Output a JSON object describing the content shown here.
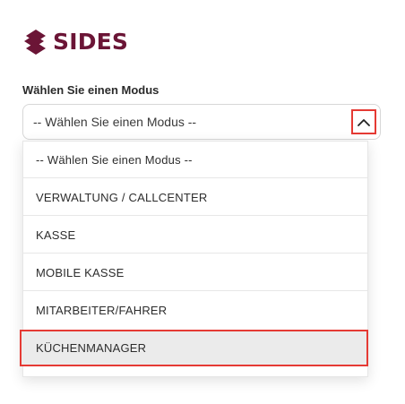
{
  "brand": {
    "name": "SIDES",
    "color": "#6b1536"
  },
  "mode_select": {
    "label": "Wählen Sie einen Modus",
    "selected": "-- Wählen Sie einen Modus --",
    "expanded": true,
    "toggle_icon": "chevron-up-icon",
    "options": [
      "-- Wählen Sie einen Modus --",
      "VERWALTUNG / CALLCENTER",
      "KASSE",
      "MOBILE KASSE",
      "MITARBEITER/FAHRER",
      "KÜCHENMANAGER"
    ],
    "highlighted_option": "KÜCHENMANAGER"
  },
  "colors": {
    "accent": "#e53a34",
    "highlight_bg": "#ebebeb"
  }
}
